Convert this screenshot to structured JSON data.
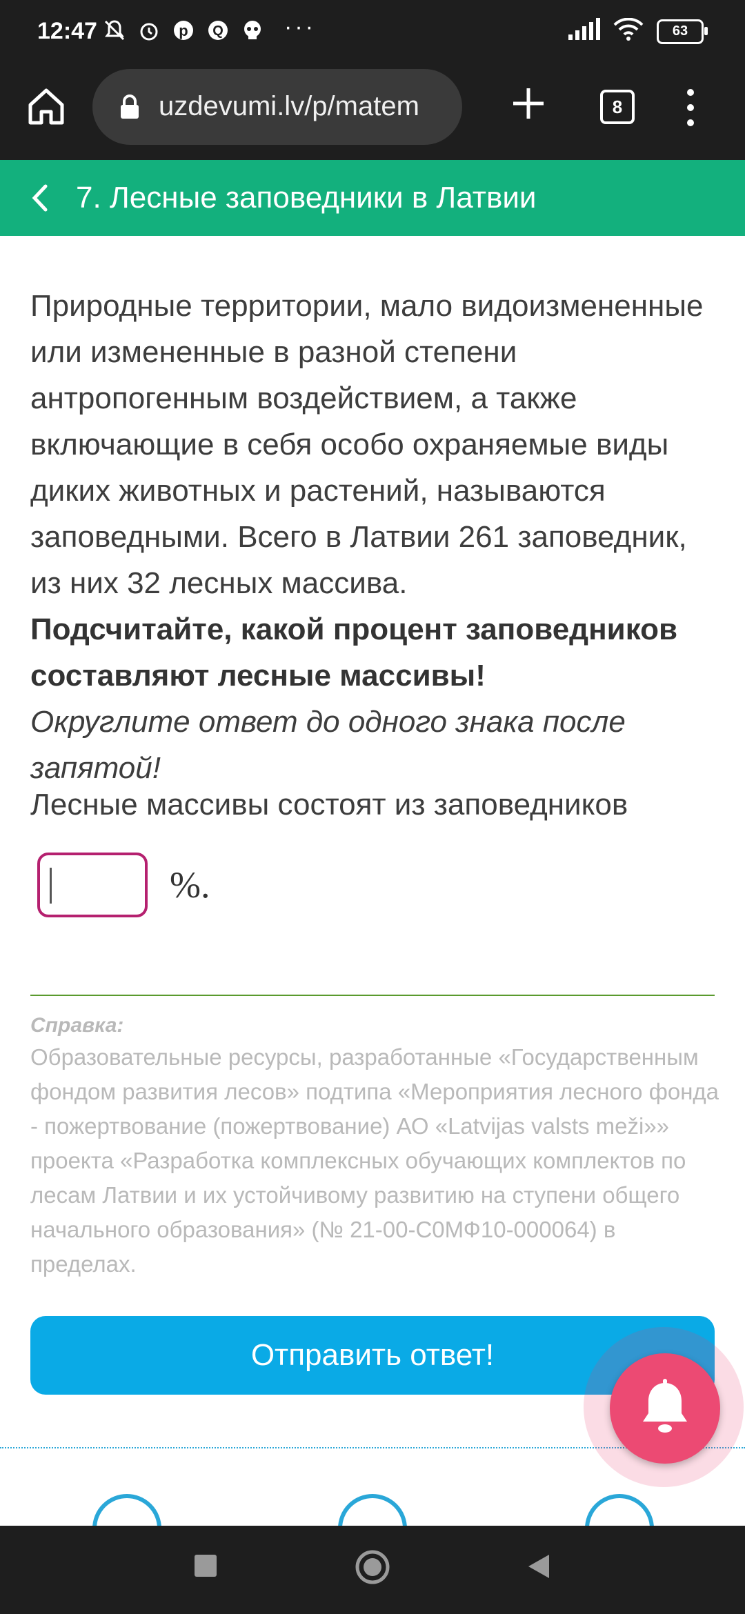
{
  "status_bar": {
    "time": "12:47",
    "battery": "63",
    "more": "···"
  },
  "browser": {
    "url": "uzdevumi.lv/p/matem",
    "tab_count": "8"
  },
  "topic": {
    "title": "7. Лесные заповедники в Латвии"
  },
  "task": {
    "paragraph": "Природные территории, мало видоизмененные или измененные в разной степени антропогенным воздействием, а также включающие в себя особо охраняемые виды диких животных и растений, называются заповедными. Всего в Латвии 261 заповедник, из них 32 лесных массива.",
    "instruction_bold": "Подсчитайте, какой процент заповедников составляют лесные массивы!",
    "instruction_italic": "Округлите ответ до одного знака после запятой!",
    "question": "Лесные массивы состоят из заповедников",
    "answer_value": "",
    "unit": "%."
  },
  "reference": {
    "label": "Справка:",
    "text": "Образовательные ресурсы, разработанные «Государственным фондом развития лесов» подтипа «Мероприятия лесного фонда - пожертвование (пожертвование) АО «Latvijas valsts meži»» проекта «Разработка комплексных обучающих комплектов по лесам Латвии и их устойчивому развитию на ступени общего начального образования» (№ 21-00-С0МФ10-000064) в пределах."
  },
  "submit_label": "Отправить ответ!",
  "colors": {
    "topic_bar": "#13b07d",
    "submit": "#0aaae6",
    "input_border": "#b5206f",
    "bell": "#ec4a73"
  },
  "icons": [
    "home-icon",
    "lock-icon",
    "plus-icon",
    "tabs-icon",
    "menu-icon",
    "back-icon",
    "bell-icon"
  ]
}
